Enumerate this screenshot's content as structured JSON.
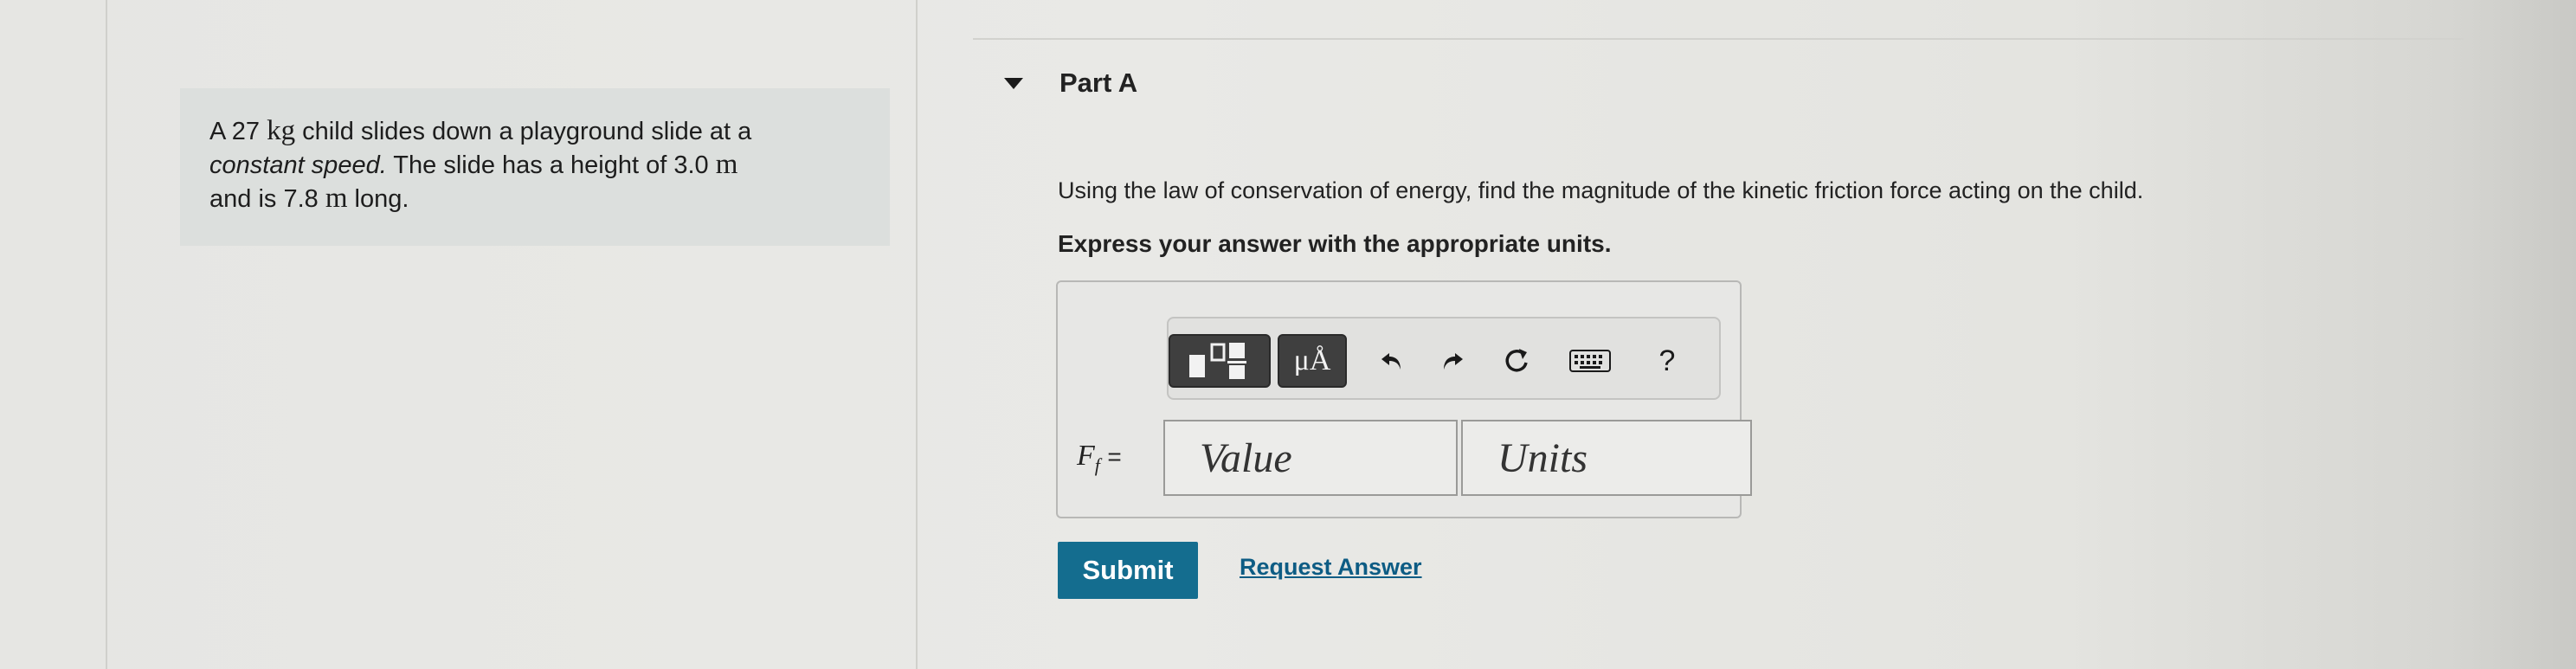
{
  "problem": {
    "line1_pre": "A 27 ",
    "line1_unit": "kg",
    "line1_post": " child slides down a playground slide at a",
    "line2_em": "constant speed.",
    "line2_post": " The slide has a height of 3.0 ",
    "line2_unit": "m",
    "line3_pre": "and is 7.8 ",
    "line3_unit": "m",
    "line3_post": " long."
  },
  "part": {
    "title": "Part A",
    "question": "Using the law of conservation of energy, find the magnitude of the kinetic friction force acting on the child.",
    "instruction": "Express your answer with the appropriate units."
  },
  "toolbar": {
    "units_button_label": "μÅ",
    "help_label": "?"
  },
  "answer": {
    "variable": "F",
    "subscript": "f",
    "equals": "=",
    "value_placeholder": "Value",
    "units_placeholder": "Units"
  },
  "actions": {
    "submit_label": "Submit",
    "request_answer_label": "Request Answer"
  },
  "colors": {
    "submit_bg": "#146d8f",
    "link": "#0d5c84",
    "problem_bg": "#dcdfdd"
  }
}
